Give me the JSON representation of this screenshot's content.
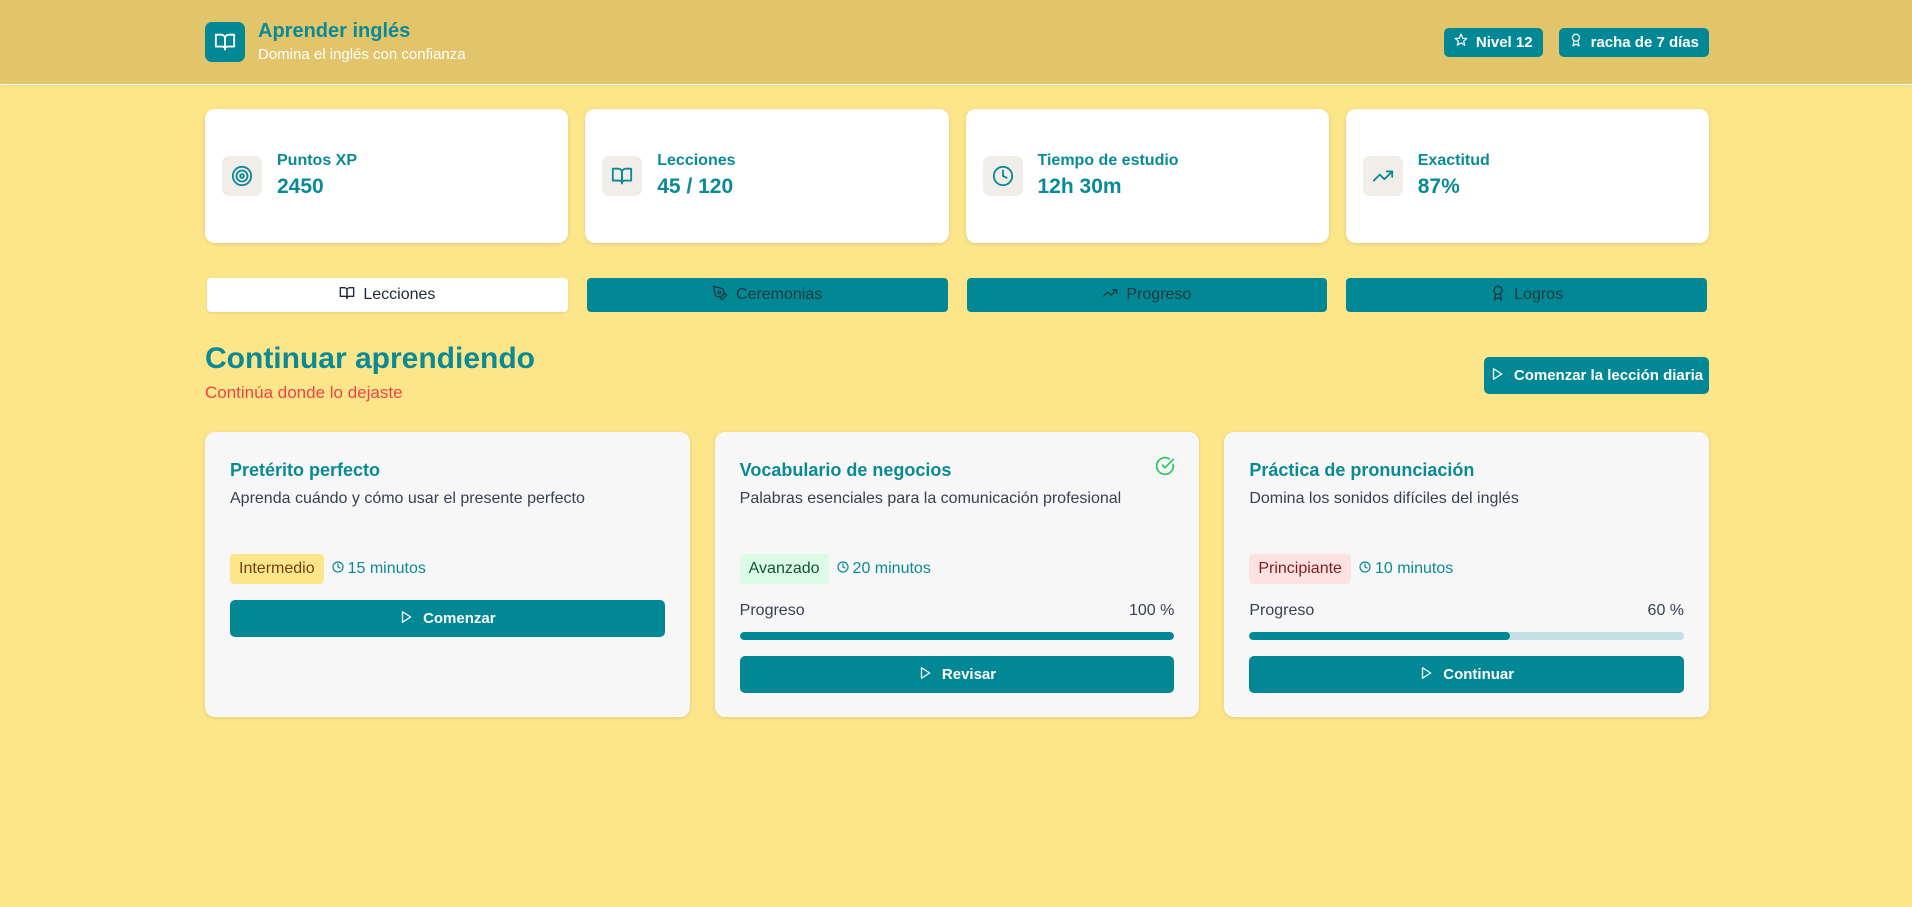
{
  "header": {
    "title": "Aprender inglés",
    "subtitle": "Domina el inglés con confianza",
    "level_badge": "Nivel 12",
    "streak_badge": "racha de 7 días"
  },
  "stats": [
    {
      "label": "Puntos XP",
      "value": "2450",
      "icon": "target-icon"
    },
    {
      "label": "Lecciones",
      "value": "45 / 120",
      "icon": "book-icon"
    },
    {
      "label": "Tiempo de estudio",
      "value": "12h 30m",
      "icon": "clock-icon"
    },
    {
      "label": "Exactitud",
      "value": "87%",
      "icon": "trending-up-icon"
    }
  ],
  "tabs": [
    {
      "label": "Lecciones",
      "active": true
    },
    {
      "label": "Ceremonias",
      "active": false
    },
    {
      "label": "Progreso",
      "active": false
    },
    {
      "label": "Logros",
      "active": false
    }
  ],
  "section": {
    "title": "Continuar aprendiendo",
    "subtitle": "Continúa donde lo dejaste",
    "daily_button": "Comenzar la lección diaria"
  },
  "lessons": [
    {
      "title": "Pretérito perfecto",
      "description": "Aprenda cuándo y cómo usar el presente perfecto",
      "level": "Intermedio",
      "duration": "15 minutos",
      "button": "Comenzar"
    },
    {
      "title": "Vocabulario de negocios",
      "description": "Palabras esenciales para la comunicación profesional",
      "level": "Avanzado",
      "duration": "20 minutos",
      "progress_label": "Progreso",
      "progress_text": "100 %",
      "progress": 100,
      "completed": true,
      "button": "Revisar"
    },
    {
      "title": "Práctica de pronunciación",
      "description": "Domina los sonidos difíciles del inglés",
      "level": "Principiante",
      "duration": "10 minutos",
      "progress_label": "Progreso",
      "progress_text": "60 %",
      "progress": 60,
      "button": "Continuar"
    }
  ],
  "colors": {
    "background": "#fde68a",
    "header": "#e2c46a",
    "primary": "#028794",
    "accent_text": "#0a8a96",
    "subtitle_red": "#ef4444",
    "success": "#22c55e"
  }
}
